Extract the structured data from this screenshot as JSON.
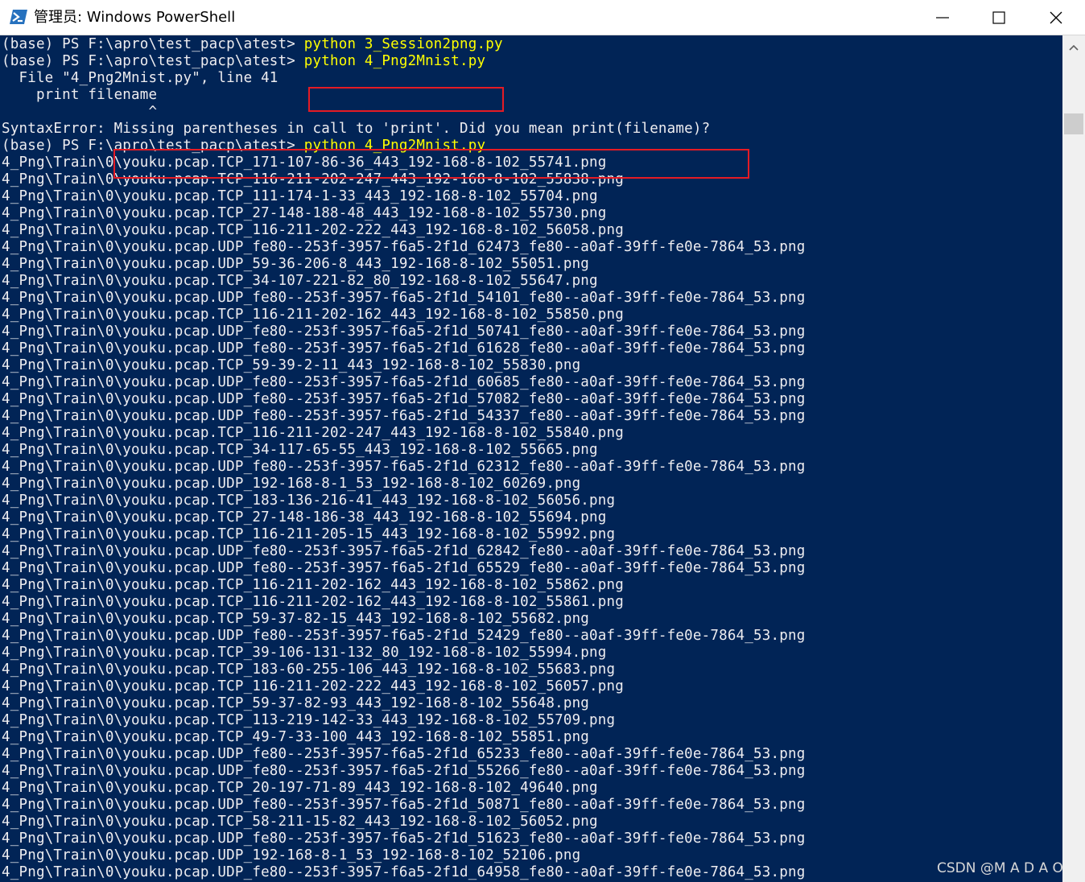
{
  "window": {
    "title": "管理员: Windows PowerShell",
    "icon": "powershell-icon"
  },
  "controls": {
    "minimize": "minimize-icon",
    "maximize": "maximize-icon",
    "close": "close-icon"
  },
  "colors": {
    "console_background": "#012456",
    "console_text": "#eeedf0",
    "command_text": "#ffff00",
    "highlight_box": "#e51b24"
  },
  "terminal": {
    "lines": [
      {
        "prompt": "(base) PS F:\\apro\\test_pacp\\atest> ",
        "command": "python 3_Session2png.py"
      },
      {
        "prompt": "(base) PS F:\\apro\\test_pacp\\atest> ",
        "command": "python 4_Png2Mnist.py"
      },
      {
        "text": "  File \"4_Png2Mnist.py\", line 41"
      },
      {
        "text": "    print filename"
      },
      {
        "text": "                 ^"
      },
      {
        "text": "SyntaxError: Missing parentheses in call to 'print'. Did you mean print(filename)?"
      },
      {
        "prompt": "(base) PS F:\\apro\\test_pacp\\atest> ",
        "command": "python 4_Png2Mnist.py"
      },
      {
        "text": "4_Png\\Train\\0\\youku.pcap.TCP_171-107-86-36_443_192-168-8-102_55741.png"
      },
      {
        "text": "4_Png\\Train\\0\\youku.pcap.TCP_116-211-202-247_443_192-168-8-102_55838.png"
      },
      {
        "text": "4_Png\\Train\\0\\youku.pcap.TCP_111-174-1-33_443_192-168-8-102_55704.png"
      },
      {
        "text": "4_Png\\Train\\0\\youku.pcap.TCP_27-148-188-48_443_192-168-8-102_55730.png"
      },
      {
        "text": "4_Png\\Train\\0\\youku.pcap.TCP_116-211-202-222_443_192-168-8-102_56058.png"
      },
      {
        "text": "4_Png\\Train\\0\\youku.pcap.UDP_fe80--253f-3957-f6a5-2f1d_62473_fe80--a0af-39ff-fe0e-7864_53.png"
      },
      {
        "text": "4_Png\\Train\\0\\youku.pcap.UDP_59-36-206-8_443_192-168-8-102_55051.png"
      },
      {
        "text": "4_Png\\Train\\0\\youku.pcap.TCP_34-107-221-82_80_192-168-8-102_55647.png"
      },
      {
        "text": "4_Png\\Train\\0\\youku.pcap.UDP_fe80--253f-3957-f6a5-2f1d_54101_fe80--a0af-39ff-fe0e-7864_53.png"
      },
      {
        "text": "4_Png\\Train\\0\\youku.pcap.TCP_116-211-202-162_443_192-168-8-102_55850.png"
      },
      {
        "text": "4_Png\\Train\\0\\youku.pcap.UDP_fe80--253f-3957-f6a5-2f1d_50741_fe80--a0af-39ff-fe0e-7864_53.png"
      },
      {
        "text": "4_Png\\Train\\0\\youku.pcap.UDP_fe80--253f-3957-f6a5-2f1d_61628_fe80--a0af-39ff-fe0e-7864_53.png"
      },
      {
        "text": "4_Png\\Train\\0\\youku.pcap.TCP_59-39-2-11_443_192-168-8-102_55830.png"
      },
      {
        "text": "4_Png\\Train\\0\\youku.pcap.UDP_fe80--253f-3957-f6a5-2f1d_60685_fe80--a0af-39ff-fe0e-7864_53.png"
      },
      {
        "text": "4_Png\\Train\\0\\youku.pcap.UDP_fe80--253f-3957-f6a5-2f1d_57082_fe80--a0af-39ff-fe0e-7864_53.png"
      },
      {
        "text": "4_Png\\Train\\0\\youku.pcap.UDP_fe80--253f-3957-f6a5-2f1d_54337_fe80--a0af-39ff-fe0e-7864_53.png"
      },
      {
        "text": "4_Png\\Train\\0\\youku.pcap.TCP_116-211-202-247_443_192-168-8-102_55840.png"
      },
      {
        "text": "4_Png\\Train\\0\\youku.pcap.TCP_34-117-65-55_443_192-168-8-102_55665.png"
      },
      {
        "text": "4_Png\\Train\\0\\youku.pcap.UDP_fe80--253f-3957-f6a5-2f1d_62312_fe80--a0af-39ff-fe0e-7864_53.png"
      },
      {
        "text": "4_Png\\Train\\0\\youku.pcap.UDP_192-168-8-1_53_192-168-8-102_60269.png"
      },
      {
        "text": "4_Png\\Train\\0\\youku.pcap.TCP_183-136-216-41_443_192-168-8-102_56056.png"
      },
      {
        "text": "4_Png\\Train\\0\\youku.pcap.TCP_27-148-186-38_443_192-168-8-102_55694.png"
      },
      {
        "text": "4_Png\\Train\\0\\youku.pcap.TCP_116-211-205-15_443_192-168-8-102_55992.png"
      },
      {
        "text": "4_Png\\Train\\0\\youku.pcap.UDP_fe80--253f-3957-f6a5-2f1d_62842_fe80--a0af-39ff-fe0e-7864_53.png"
      },
      {
        "text": "4_Png\\Train\\0\\youku.pcap.UDP_fe80--253f-3957-f6a5-2f1d_65529_fe80--a0af-39ff-fe0e-7864_53.png"
      },
      {
        "text": "4_Png\\Train\\0\\youku.pcap.TCP_116-211-202-162_443_192-168-8-102_55862.png"
      },
      {
        "text": "4_Png\\Train\\0\\youku.pcap.TCP_116-211-202-162_443_192-168-8-102_55861.png"
      },
      {
        "text": "4_Png\\Train\\0\\youku.pcap.TCP_59-37-82-15_443_192-168-8-102_55682.png"
      },
      {
        "text": "4_Png\\Train\\0\\youku.pcap.UDP_fe80--253f-3957-f6a5-2f1d_52429_fe80--a0af-39ff-fe0e-7864_53.png"
      },
      {
        "text": "4_Png\\Train\\0\\youku.pcap.TCP_39-106-131-132_80_192-168-8-102_55994.png"
      },
      {
        "text": "4_Png\\Train\\0\\youku.pcap.TCP_183-60-255-106_443_192-168-8-102_55683.png"
      },
      {
        "text": "4_Png\\Train\\0\\youku.pcap.TCP_116-211-202-222_443_192-168-8-102_56057.png"
      },
      {
        "text": "4_Png\\Train\\0\\youku.pcap.TCP_59-37-82-93_443_192-168-8-102_55648.png"
      },
      {
        "text": "4_Png\\Train\\0\\youku.pcap.TCP_113-219-142-33_443_192-168-8-102_55709.png"
      },
      {
        "text": "4_Png\\Train\\0\\youku.pcap.TCP_49-7-33-100_443_192-168-8-102_55851.png"
      },
      {
        "text": "4_Png\\Train\\0\\youku.pcap.UDP_fe80--253f-3957-f6a5-2f1d_65233_fe80--a0af-39ff-fe0e-7864_53.png"
      },
      {
        "text": "4_Png\\Train\\0\\youku.pcap.UDP_fe80--253f-3957-f6a5-2f1d_55266_fe80--a0af-39ff-fe0e-7864_53.png"
      },
      {
        "text": "4_Png\\Train\\0\\youku.pcap.TCP_20-197-71-89_443_192-168-8-102_49640.png"
      },
      {
        "text": "4_Png\\Train\\0\\youku.pcap.UDP_fe80--253f-3957-f6a5-2f1d_50871_fe80--a0af-39ff-fe0e-7864_53.png"
      },
      {
        "text": "4_Png\\Train\\0\\youku.pcap.TCP_58-211-15-82_443_192-168-8-102_56052.png"
      },
      {
        "text": "4_Png\\Train\\0\\youku.pcap.UDP_fe80--253f-3957-f6a5-2f1d_51623_fe80--a0af-39ff-fe0e-7864_53.png"
      },
      {
        "text": "4_Png\\Train\\0\\youku.pcap.UDP_192-168-8-1_53_192-168-8-102_52106.png"
      },
      {
        "text": "4_Png\\Train\\0\\youku.pcap.UDP_fe80--253f-3957-f6a5-2f1d_64958_fe80--a0af-39ff-fe0e-7864_53.png"
      }
    ]
  },
  "scrollbar": {
    "up_arrow": "chevron-up-icon"
  },
  "watermark": {
    "text": "CSDN @M A D A O"
  }
}
